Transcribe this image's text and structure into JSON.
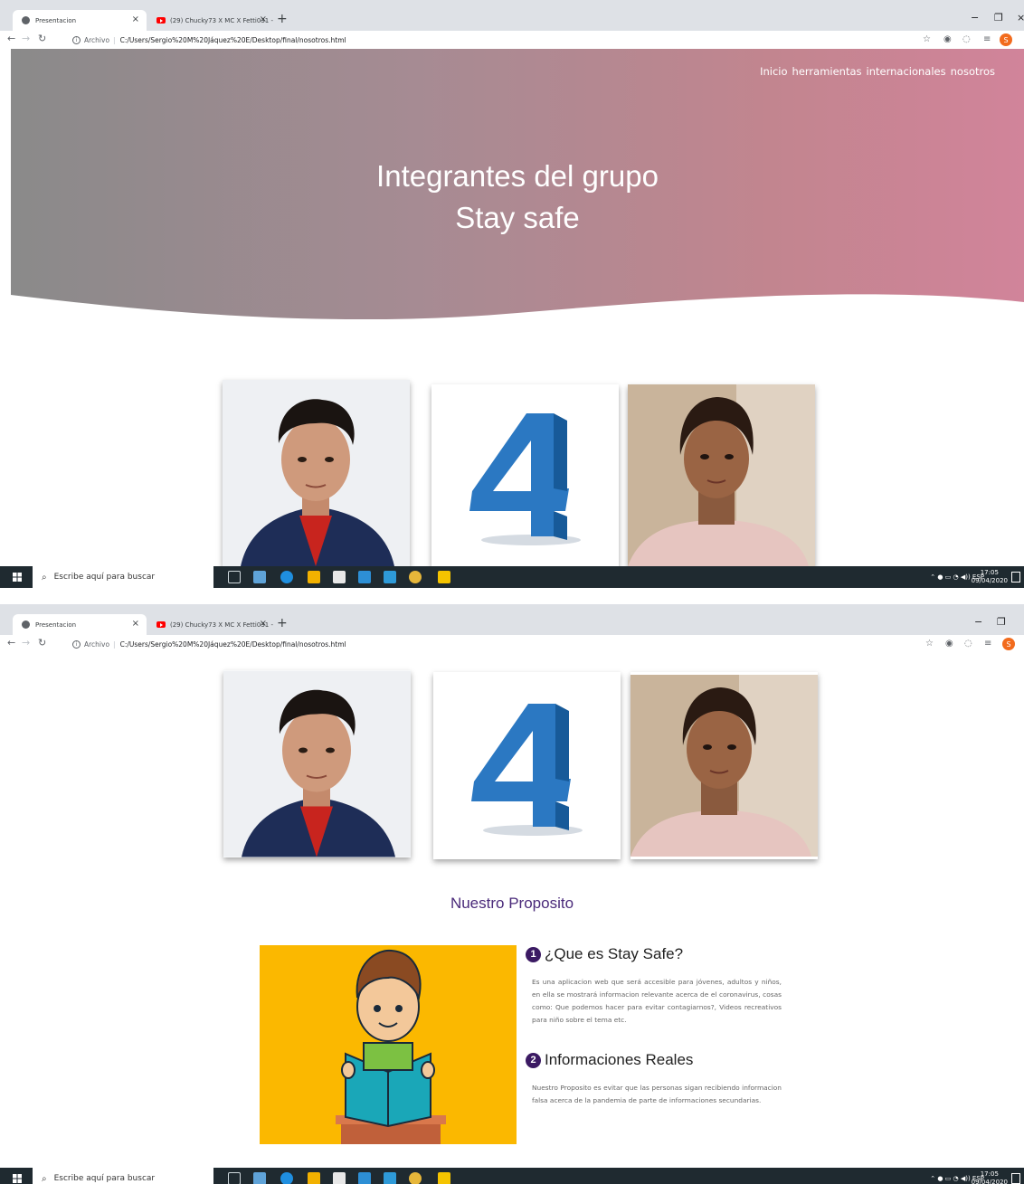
{
  "browser": {
    "active_tab": "Presentacion",
    "other_tab": "(29) Chucky73 X MC X Fetti031 -",
    "url_label": "Archivo",
    "url": "C:/Users/Sergio%20M%20Jáquez%20E/Desktop/final/nosotros.html",
    "profile_initial": "S"
  },
  "nav": {
    "items": [
      "Inicio",
      "herramientas",
      "internacionales",
      "nosotros"
    ]
  },
  "hero": {
    "line1": "Integrantes del grupo",
    "line2": "Stay safe",
    "gradient": [
      "#8a8a8a",
      "#d1849a"
    ]
  },
  "members": [
    {
      "icon": "member-photo-man"
    },
    {
      "icon": "number-4-logo"
    },
    {
      "icon": "member-photo-woman"
    }
  ],
  "proposito": {
    "title": "Nuestro Proposito",
    "items": [
      {
        "number": "1",
        "heading": "¿Que es Stay Safe?",
        "text": "Es una aplicacion web que será accesible para jóvenes, adultos y niños, en ella se mostrará informacion relevante acerca de el coronavirus, cosas como: Que podemos hacer para evitar contagiarnos?, Videos recreativos para niño sobre el tema etc."
      },
      {
        "number": "2",
        "heading": "Informaciones Reales",
        "text": "Nuestro Proposito es evitar que las personas sigan recibiendo informacion falsa acerca de la pandemia de parte de informaciones secundarias."
      }
    ]
  },
  "taskbar": {
    "search_placeholder": "Escribe aquí para buscar",
    "language": "ESP",
    "time": "17:05",
    "date": "09/04/2020"
  },
  "colors": {
    "accent": "#4a2a7a",
    "badge": "#3b1a63",
    "kid_bg": "#fbb800"
  }
}
